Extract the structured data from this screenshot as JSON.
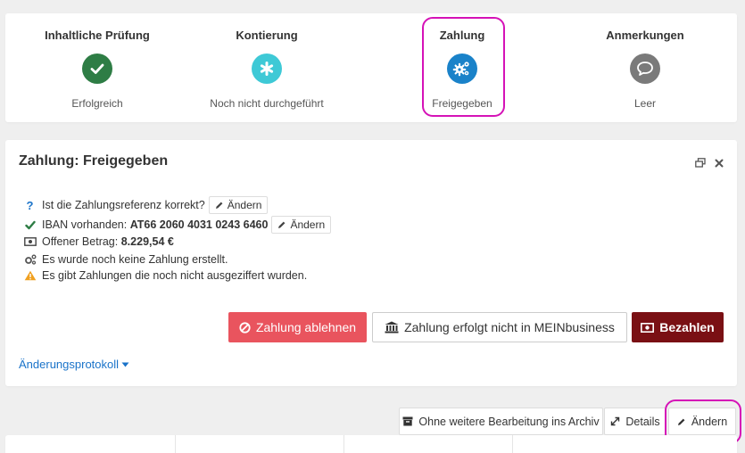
{
  "steps": [
    {
      "title": "Inhaltliche Prüfung",
      "status": "Erfolgreich",
      "icon": "check-icon",
      "color": "#2e7d45"
    },
    {
      "title": "Kontierung",
      "status": "Noch nicht durchgeführt",
      "icon": "asterisk-icon",
      "color": "#3ec9d6"
    },
    {
      "title": "Zahlung",
      "status": "Freigegeben",
      "icon": "cogs-icon",
      "color": "#1a82c9"
    },
    {
      "title": "Anmerkungen",
      "status": "Leer",
      "icon": "comment-icon",
      "color": "#7a7a7a"
    }
  ],
  "main": {
    "title": "Zahlung: Freigegeben",
    "info": {
      "ref_question": "Ist die Zahlungsreferenz korrekt?",
      "iban_label": "IBAN vorhanden:",
      "iban_value": "AT66 2060 4031 0243 6460",
      "amount_label": "Offener Betrag:",
      "amount_value": "8.229,54 €",
      "no_payment": "Es wurde noch keine Zahlung erstellt.",
      "warning": "Es gibt Zahlungen die noch nicht ausgeziffert wurden."
    },
    "change_label": "Ändern",
    "buttons": {
      "reject": "Zahlung ablehnen",
      "external": "Zahlung erfolgt nicht in MEINbusiness",
      "pay": "Bezahlen"
    },
    "changelog": "Änderungsprotokoll"
  },
  "toolbar": {
    "archive": "Ohne weitere Bearbeitung ins Archiv",
    "details": "Details",
    "edit": "Ändern"
  },
  "colors": {
    "highlight": "#d512b7",
    "reject": "#e9545e",
    "pay": "#7a1014",
    "link": "#1a73c9"
  }
}
